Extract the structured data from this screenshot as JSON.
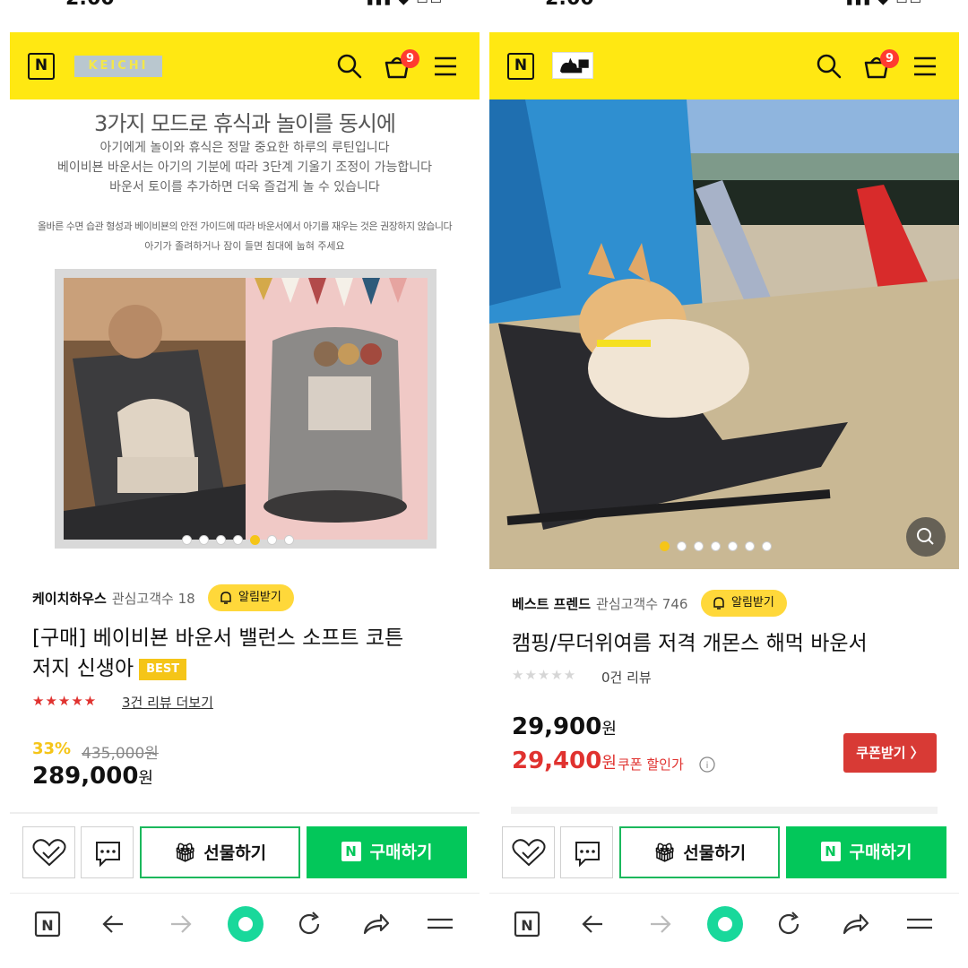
{
  "status": {
    "time": "2:00",
    "signal": "▮▮▮ ◆ ▭▭"
  },
  "header": {
    "cart_count": "9"
  },
  "left": {
    "store_logo": "KEICHI",
    "banner": {
      "title": "3가지 모드로 휴식과 놀이를 동시에",
      "lines": [
        "아기에게 놀이와 휴식은 정말 중요한 하루의 루틴입니다",
        "베이비뵨 바운서는 아기의 기분에 따라 3단계 기울기 조정이 가능합니다",
        "바운서 토이를 추가하면 더욱 즐겁게 놀 수 있습니다"
      ],
      "notes": [
        "올바른 수면 습관 형성과 베이비뵨의 안전 가이드에 따라 바운서에서 아기를 재우는 것은 권장하지 않습니다",
        "아기가 졸려하거나 잠이 들면 침대에 눕혀 주세요"
      ]
    },
    "seller": "케이치하우스",
    "fans": "관심고객수 18",
    "alarm": "알림받기",
    "product_name_1": "[구매] 베이비뵨 바운서 밸런스 소프트 코튼",
    "product_name_2": "저지 신생아",
    "best": "BEST",
    "stars": "★★★★★",
    "review": "3건 리뷰 더보기",
    "discount": "33%",
    "old_price": "435,000원",
    "price": "289,000",
    "won": "원"
  },
  "right": {
    "seller": "베스트 프렌드",
    "fans": "관심고객수 746",
    "alarm": "알림받기",
    "product_name": "캠핑/무더위여름 저격 개몬스 해먹 바운서",
    "stars": "★★★★★",
    "review": "0건 리뷰",
    "price": "29,900",
    "coupon_price": "29,400",
    "won": "원",
    "coupon_text": "쿠폰 할인가",
    "coupon_btn": "쿠폰받기 〉"
  },
  "actions": {
    "gift": "선물하기",
    "buy": "구매하기"
  },
  "colors": {
    "header": "#ffe812",
    "green": "#03c75a",
    "red": "#e0322f",
    "gold": "#f5c518"
  }
}
